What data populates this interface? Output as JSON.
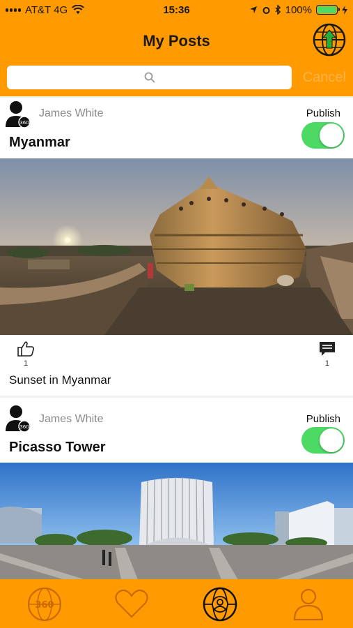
{
  "status": {
    "carrier": "AT&T 4G",
    "time": "15:36",
    "battery": "100%"
  },
  "header": {
    "title": "My Posts",
    "cancel_label": "Cancel",
    "search_placeholder": ""
  },
  "posts": [
    {
      "author": "James White",
      "title": "Myanmar",
      "publish_label": "Publish",
      "published": true,
      "likes": "1",
      "comments": "1",
      "caption": "Sunset in Myanmar"
    },
    {
      "author": "James White",
      "title": "Picasso Tower",
      "publish_label": "Publish",
      "published": true
    }
  ],
  "tabbar": {
    "items": [
      "360-globe-icon",
      "heart-icon",
      "profile-globe-icon",
      "user-icon"
    ]
  },
  "colors": {
    "brand": "#ff9a00",
    "toggle_on": "#4cd964",
    "tab_icon": "#c96a00",
    "cancel": "#ffb34a"
  }
}
